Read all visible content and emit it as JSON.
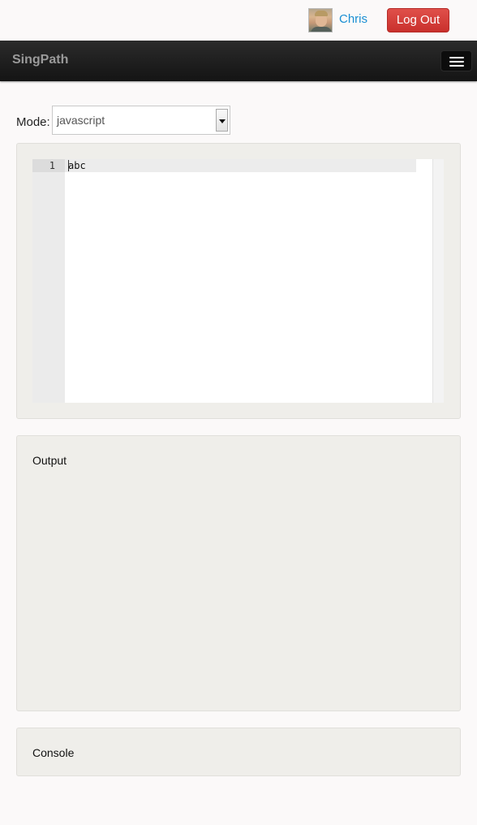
{
  "user": {
    "name": "Chris",
    "logout_label": "Log Out"
  },
  "navbar": {
    "brand": "SingPath",
    "toggle_icon": "hamburger-menu-icon"
  },
  "mode": {
    "label": "Mode:",
    "selected": "javascript"
  },
  "editor": {
    "lines": [
      {
        "number": "1",
        "text": "abc"
      }
    ]
  },
  "output": {
    "title": "Output"
  },
  "console": {
    "title": "Console"
  },
  "colors": {
    "link": "#1a8fd3",
    "logout": "#d9534f",
    "navbar": "#1b1b1b",
    "well": "#efeeea"
  }
}
